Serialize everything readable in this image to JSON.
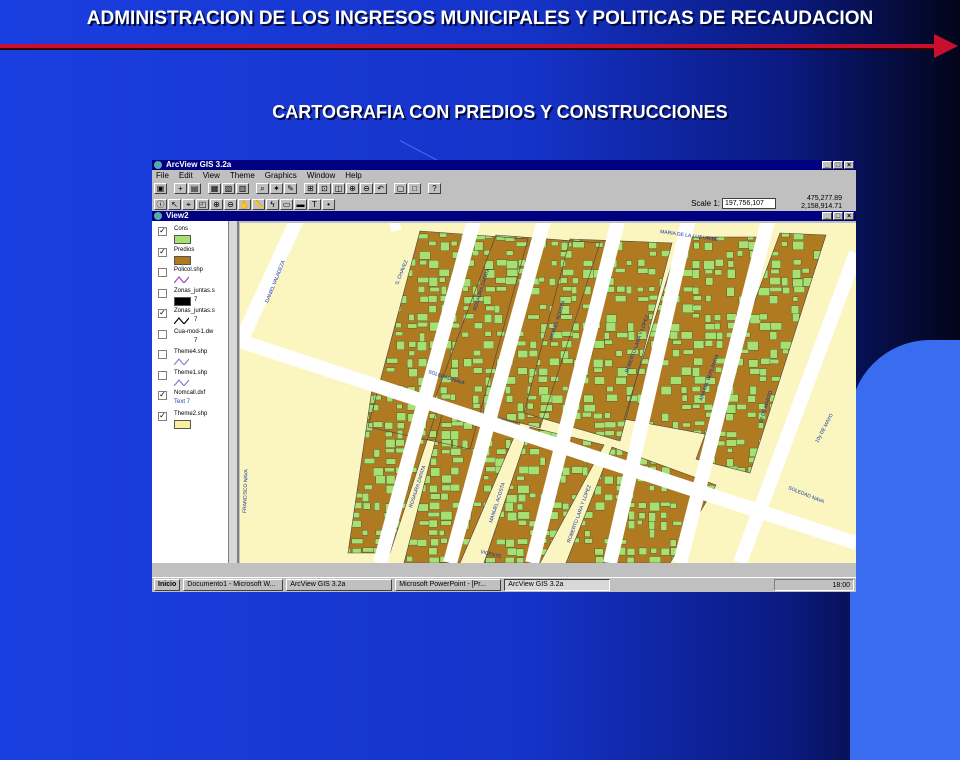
{
  "slide": {
    "title": "ADMINISTRACION DE LOS INGRESOS MUNICIPALES Y POLITICAS DE RECAUDACION",
    "subtitle": "CARTOGRAFIA CON PREDIOS Y CONSTRUCCIONES",
    "accent_color": "#c8102e",
    "background_color": "#1a3fe0"
  },
  "app": {
    "title": "ArcView GIS 3.2a",
    "menu": [
      "File",
      "Edit",
      "View",
      "Theme",
      "Graphics",
      "Window",
      "Help"
    ],
    "window_buttons": [
      "_",
      "□",
      "×"
    ],
    "scale_label": "Scale 1:",
    "scale_value": "197,756,107",
    "coord_x": "475,277.89",
    "coord_y": "2,158,914.71"
  },
  "view": {
    "title": "View2",
    "layers": [
      {
        "name": "Cons",
        "checked": true,
        "symbol": "fill",
        "color": "#a6e070"
      },
      {
        "name": "Predios",
        "checked": true,
        "symbol": "fill",
        "color": "#b07a20"
      },
      {
        "name": "Policol.shp",
        "checked": false,
        "symbol": "line",
        "color": "#a040c0"
      },
      {
        "name": "Zonas_juntas.s",
        "checked": false,
        "symbol": "fill",
        "color": "#000000",
        "extra": "7"
      },
      {
        "name": "Zonas_juntas.s",
        "checked": true,
        "symbol": "line",
        "color": "#000000",
        "extra": "7"
      },
      {
        "name": "Cua-mod-1.dw",
        "checked": false,
        "symbol": "none",
        "color": "",
        "extra": "7"
      },
      {
        "name": "Theme4.shp",
        "checked": false,
        "symbol": "line",
        "color": "#8080d0"
      },
      {
        "name": "Theme1.shp",
        "checked": false,
        "symbol": "line",
        "color": "#8080d0"
      },
      {
        "name": "Nomcall.dxf",
        "checked": true,
        "symbol": "text",
        "color": "#2040c0",
        "extra": "Text 7"
      },
      {
        "name": "Theme2.shp",
        "checked": true,
        "symbol": "fill",
        "color": "#f8f0a0"
      }
    ]
  },
  "map": {
    "street_labels": [
      "MARIA DE LA LUZ URIBE",
      "DANIEL VALADEZA",
      "S. CHAVEZ",
      "ROSAURA ZAPATA",
      "MANUEL ACOSTA",
      "ROBERTO LARA Y LOPEZ",
      "ANA MA. BERLANGA",
      "16 DE MARZO",
      "SOLEDAD NAVA",
      "FRANCISCO NAVA",
      "ROSAURA ZAPATA",
      "MANUEL ACOSTA",
      "ROBERTO LARA Y LOPEZ",
      "SOLEDAD NAVA",
      "10y DE MAYO",
      "VICENTE"
    ],
    "colors": {
      "background": "#fbf6c0",
      "construction": "#a6e070",
      "parcel": "#b07a20"
    }
  },
  "taskbar": {
    "start": "Inicio",
    "tasks": [
      "Documento1 - Microsoft W...",
      "ArcView GIS 3.2a",
      "Microsoft PowerPoint - [Pr...",
      "ArcView GIS 3.2a"
    ],
    "clock": "18:00"
  }
}
